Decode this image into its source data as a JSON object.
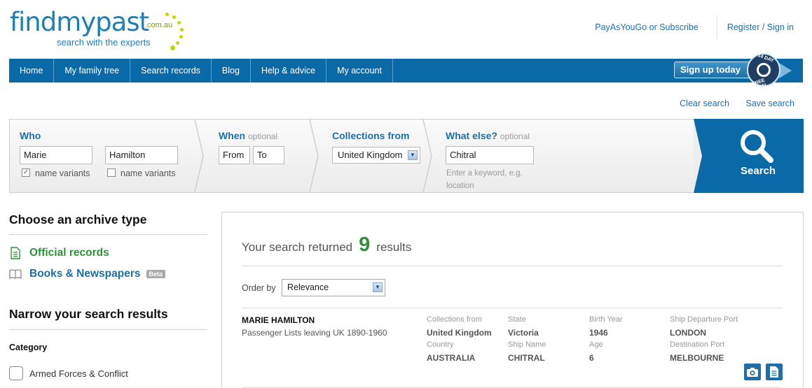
{
  "brand": {
    "logo_text": "findmypast",
    "tld": ".com.au",
    "tagline": "search with the experts"
  },
  "top_links": {
    "subscribe": "PayAsYouGo or Subscribe",
    "register": "Register / Sign in"
  },
  "nav": {
    "items": [
      "Home",
      "My family tree",
      "Search records",
      "Blog",
      "Help & advice",
      "My account"
    ],
    "signup_label": "Sign up today",
    "trial_badge_top": "14 DAY",
    "trial_badge_bottom": "FREE TRIAL"
  },
  "actions": {
    "clear": "Clear search",
    "save": "Save search"
  },
  "search": {
    "who_label": "Who",
    "first_name": "Marie",
    "last_name": "Hamilton",
    "name_variants_label": "name variants",
    "first_variants_checked": true,
    "last_variants_checked": false,
    "when_label": "When",
    "optional": "optional",
    "from_placeholder": "From",
    "to_placeholder": "To",
    "collections_label": "Collections from",
    "collection_value": "United Kingdom",
    "what_else_label": "What else?",
    "keyword_value": "Chitral",
    "keyword_hint": "Enter a keyword, e.g. location",
    "button_label": "Search"
  },
  "sidebar": {
    "archive_heading": "Choose an archive type",
    "archive_official": "Official records",
    "archive_books": "Books & Newspapers",
    "beta": "Beta",
    "narrow_heading": "Narrow your search results",
    "category_label": "Category",
    "category_items": [
      "Armed Forces & Conflict"
    ]
  },
  "results": {
    "prefix": "Your search returned",
    "count": "9",
    "suffix": "results",
    "order_label": "Order by",
    "order_value": "Relevance",
    "records": [
      {
        "name": "MARIE HAMILTON",
        "collection": "Passenger Lists leaving UK 1890-1960",
        "collections_from_label": "Collections from",
        "collections_from": "United Kingdom",
        "state_label": "State",
        "state": "Victoria",
        "birth_year_label": "Birth Year",
        "birth_year": "1946",
        "departure_label": "Ship Departure Port",
        "departure": "LONDON",
        "country_label": "Country",
        "country": "AUSTRALIA",
        "ship_label": "Ship Name",
        "ship": "CHITRAL",
        "age_label": "Age",
        "age": "6",
        "destination_label": "Destination Port",
        "destination": "MELBOURNE"
      }
    ]
  },
  "colors": {
    "brand_blue": "#0a6aa8",
    "link_blue": "#1f6ea8",
    "green": "#2e9138",
    "lime": "#c4d600"
  }
}
